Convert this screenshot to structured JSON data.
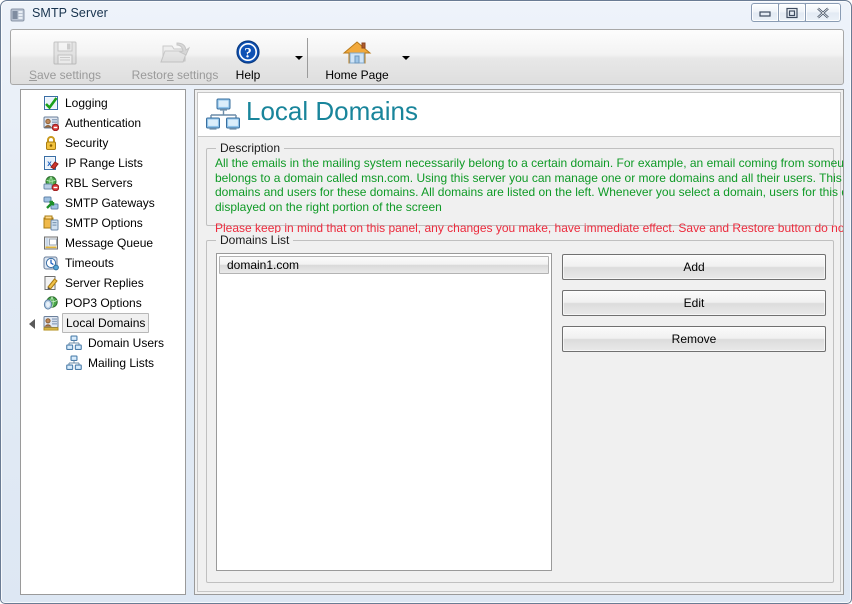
{
  "window": {
    "title": "SMTP Server",
    "icon": "app-window-icon",
    "controls": {
      "minimize": "minimize-icon",
      "maximize": "maximize-icon",
      "close": "close-icon"
    }
  },
  "toolbar": {
    "buttons": [
      {
        "id": "save",
        "label_pre": "S",
        "label_post": "ave settings",
        "icon": "save-disk-icon",
        "enabled": false
      },
      {
        "id": "restore",
        "label_pre": "R",
        "label_post": "estore settings",
        "icon": "open-folder-icon",
        "enabled": false
      },
      {
        "id": "help",
        "label_pre": "H",
        "label_post": "elp",
        "icon": "help-question-icon",
        "enabled": true
      },
      {
        "id": "home",
        "label_pre": "H",
        "label_post": "ome Page",
        "icon": "home-house-icon",
        "enabled": true
      }
    ],
    "help_dropdown": "chevron-down-icon",
    "home_dropdown": "chevron-down-icon",
    "save_label": "Save settings",
    "restore_label": "Restore settings",
    "help_label": "Help",
    "home_label": "Home Page"
  },
  "sidebar": {
    "items": [
      {
        "label": "Logging",
        "icon": "checklist-icon",
        "level": 1,
        "selected": false
      },
      {
        "label": "Authentication",
        "icon": "user-card-icon",
        "level": 1,
        "selected": false
      },
      {
        "label": "Security",
        "icon": "padlock-icon",
        "level": 1,
        "selected": false
      },
      {
        "label": "IP Range Lists",
        "icon": "ip-list-icon",
        "level": 1,
        "selected": false
      },
      {
        "label": "RBL Servers",
        "icon": "globe-block-icon",
        "level": 1,
        "selected": false
      },
      {
        "label": "SMTP Gateways",
        "icon": "gateway-arrow-icon",
        "level": 1,
        "selected": false
      },
      {
        "label": "SMTP Options",
        "icon": "options-box-icon",
        "level": 1,
        "selected": false
      },
      {
        "label": "Message Queue",
        "icon": "queue-list-icon",
        "level": 1,
        "selected": false
      },
      {
        "label": "Timeouts",
        "icon": "clock-icon",
        "level": 1,
        "selected": false
      },
      {
        "label": "Server Replies",
        "icon": "edit-pencil-icon",
        "level": 1,
        "selected": false
      },
      {
        "label": "POP3 Options",
        "icon": "pop3-globe-icon",
        "level": 1,
        "selected": false
      },
      {
        "label": "Local Domains",
        "icon": "domain-card-icon",
        "level": 1,
        "selected": true,
        "expanded": true
      },
      {
        "label": "Domain Users",
        "icon": "network-pcs-icon",
        "level": 2,
        "selected": false
      },
      {
        "label": "Mailing Lists",
        "icon": "network-pcs-icon",
        "level": 2,
        "selected": false
      }
    ]
  },
  "page": {
    "title": "Local Domains",
    "title_icon": "network-pcs-icon",
    "title_color": "#19859b",
    "description": {
      "legend": "Description",
      "info_color": "#0f9a26",
      "warning_color": "#ec2a3c",
      "info_lines": [
        "All the emails in the mailing system necessarily belong to a certain domain. For example, an email coming from someuser@msn.com",
        "belongs to a domain called msn.com. Using this server you can manage one or more domains and all their users. This is a list of",
        "domains and users for these domains. All domains are listed on the left. Whenever you select a domain, users for this domain will be",
        "displayed on the right portion of the screen"
      ],
      "warning_line": "Please keep in mind that on this panel, any changes you make, have immediate effect. Save and Restore button do not apply"
    },
    "domains": {
      "legend": "Domains List",
      "items": [
        {
          "name": "domain1.com",
          "selected": true
        }
      ],
      "buttons": {
        "add": "Add",
        "edit": "Edit",
        "remove": "Remove"
      }
    }
  }
}
